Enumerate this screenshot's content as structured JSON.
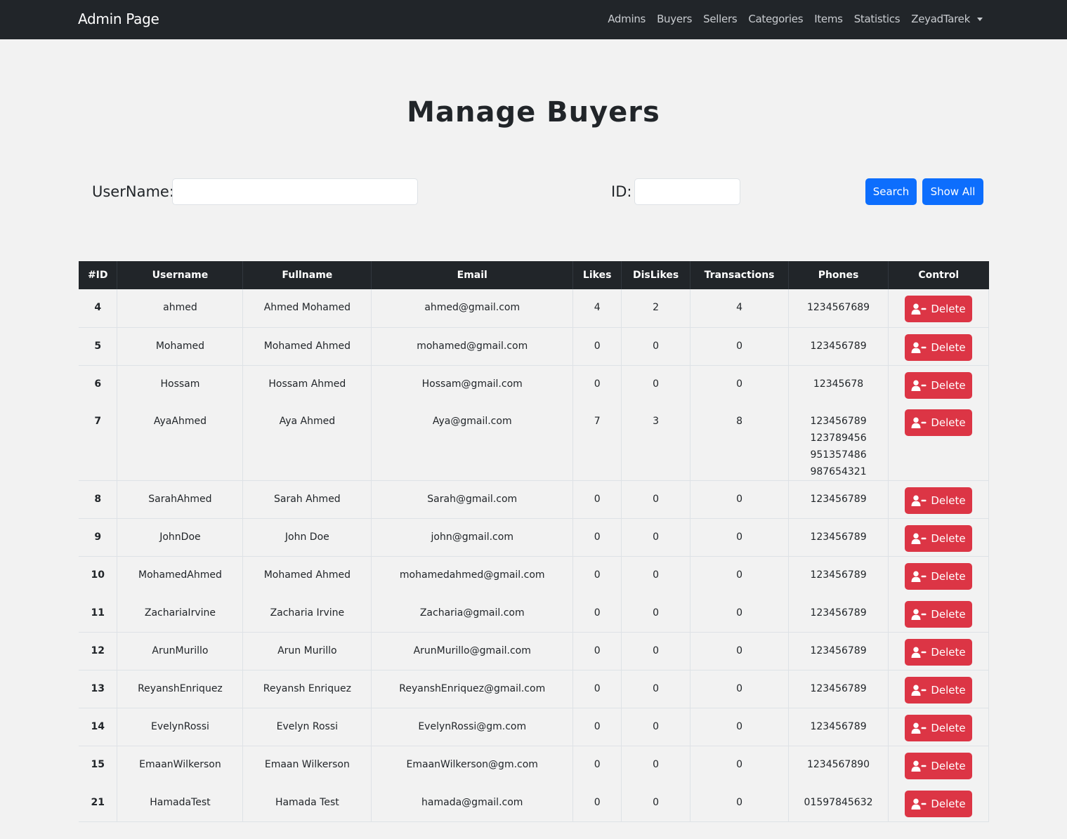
{
  "navbar": {
    "brand": "Admin Page",
    "links": [
      {
        "label": "Admins"
      },
      {
        "label": "Buyers"
      },
      {
        "label": "Sellers"
      },
      {
        "label": "Categories"
      },
      {
        "label": "Items"
      },
      {
        "label": "Statistics"
      }
    ],
    "user": "ZeyadTarek"
  },
  "page": {
    "title": "Manage Buyers"
  },
  "search": {
    "username_label": "UserName:",
    "username_value": "",
    "id_label": "ID:",
    "id_value": "",
    "search_button": "Search",
    "show_all_button": "Show All"
  },
  "table": {
    "headers": [
      "#ID",
      "Username",
      "Fullname",
      "Email",
      "Likes",
      "DisLikes",
      "Transactions",
      "Phones",
      "Control"
    ],
    "delete_label": "Delete",
    "rows": [
      {
        "id": "4",
        "username": "ahmed",
        "fullname": "Ahmed Mohamed",
        "email": "ahmed@gmail.com",
        "likes": "4",
        "dislikes": "2",
        "transactions": "4",
        "phones": [
          "1234567689"
        ],
        "bottom_border": true
      },
      {
        "id": "5",
        "username": "Mohamed",
        "fullname": "Mohamed Ahmed",
        "email": "mohamed@gmail.com",
        "likes": "0",
        "dislikes": "0",
        "transactions": "0",
        "phones": [
          "123456789"
        ],
        "bottom_border": true
      },
      {
        "id": "6",
        "username": "Hossam",
        "fullname": "Hossam Ahmed",
        "email": "Hossam@gmail.com",
        "likes": "0",
        "dislikes": "0",
        "transactions": "0",
        "phones": [
          "12345678"
        ],
        "bottom_border": false
      },
      {
        "id": "7",
        "username": "AyaAhmed",
        "fullname": "Aya Ahmed",
        "email": "Aya@gmail.com",
        "likes": "7",
        "dislikes": "3",
        "transactions": "8",
        "phones": [
          "123456789",
          "123789456",
          "951357486",
          "987654321"
        ],
        "bottom_border": true
      },
      {
        "id": "8",
        "username": "SarahAhmed",
        "fullname": "Sarah Ahmed",
        "email": "Sarah@gmail.com",
        "likes": "0",
        "dislikes": "0",
        "transactions": "0",
        "phones": [
          "123456789"
        ],
        "bottom_border": true
      },
      {
        "id": "9",
        "username": "JohnDoe",
        "fullname": "John Doe",
        "email": "john@gmail.com",
        "likes": "0",
        "dislikes": "0",
        "transactions": "0",
        "phones": [
          "123456789"
        ],
        "bottom_border": true
      },
      {
        "id": "10",
        "username": "MohamedAhmed",
        "fullname": "Mohamed Ahmed",
        "email": "mohamedahmed@gmail.com",
        "likes": "0",
        "dislikes": "0",
        "transactions": "0",
        "phones": [
          "123456789"
        ],
        "bottom_border": false
      },
      {
        "id": "11",
        "username": "ZachariaIrvine",
        "fullname": "Zacharia Irvine",
        "email": "Zacharia@gmail.com",
        "likes": "0",
        "dislikes": "0",
        "transactions": "0",
        "phones": [
          "123456789"
        ],
        "bottom_border": true
      },
      {
        "id": "12",
        "username": "ArunMurillo",
        "fullname": "Arun Murillo",
        "email": "ArunMurillo@gmail.com",
        "likes": "0",
        "dislikes": "0",
        "transactions": "0",
        "phones": [
          "123456789"
        ],
        "bottom_border": true
      },
      {
        "id": "13",
        "username": "ReyanshEnriquez",
        "fullname": "Reyansh Enriquez",
        "email": "ReyanshEnriquez@gmail.com",
        "likes": "0",
        "dislikes": "0",
        "transactions": "0",
        "phones": [
          "123456789"
        ],
        "bottom_border": true
      },
      {
        "id": "14",
        "username": "EvelynRossi",
        "fullname": "Evelyn Rossi",
        "email": "EvelynRossi@gm.com",
        "likes": "0",
        "dislikes": "0",
        "transactions": "0",
        "phones": [
          "123456789"
        ],
        "bottom_border": true
      },
      {
        "id": "15",
        "username": "EmaanWilkerson",
        "fullname": "Emaan Wilkerson",
        "email": "EmaanWilkerson@gm.com",
        "likes": "0",
        "dislikes": "0",
        "transactions": "0",
        "phones": [
          "1234567890"
        ],
        "bottom_border": false
      },
      {
        "id": "21",
        "username": "HamadaTest",
        "fullname": "Hamada Test",
        "email": "hamada@gmail.com",
        "likes": "0",
        "dislikes": "0",
        "transactions": "0",
        "phones": [
          "01597845632"
        ],
        "bottom_border": true
      }
    ]
  },
  "icons": {
    "delete_icon": "user-minus-icon",
    "user_dropdown": "chevron-down-icon"
  },
  "colors": {
    "navbar": "#212529",
    "primary": "#0d6efd",
    "danger": "#dc3545",
    "background": "#f2f2f2"
  }
}
